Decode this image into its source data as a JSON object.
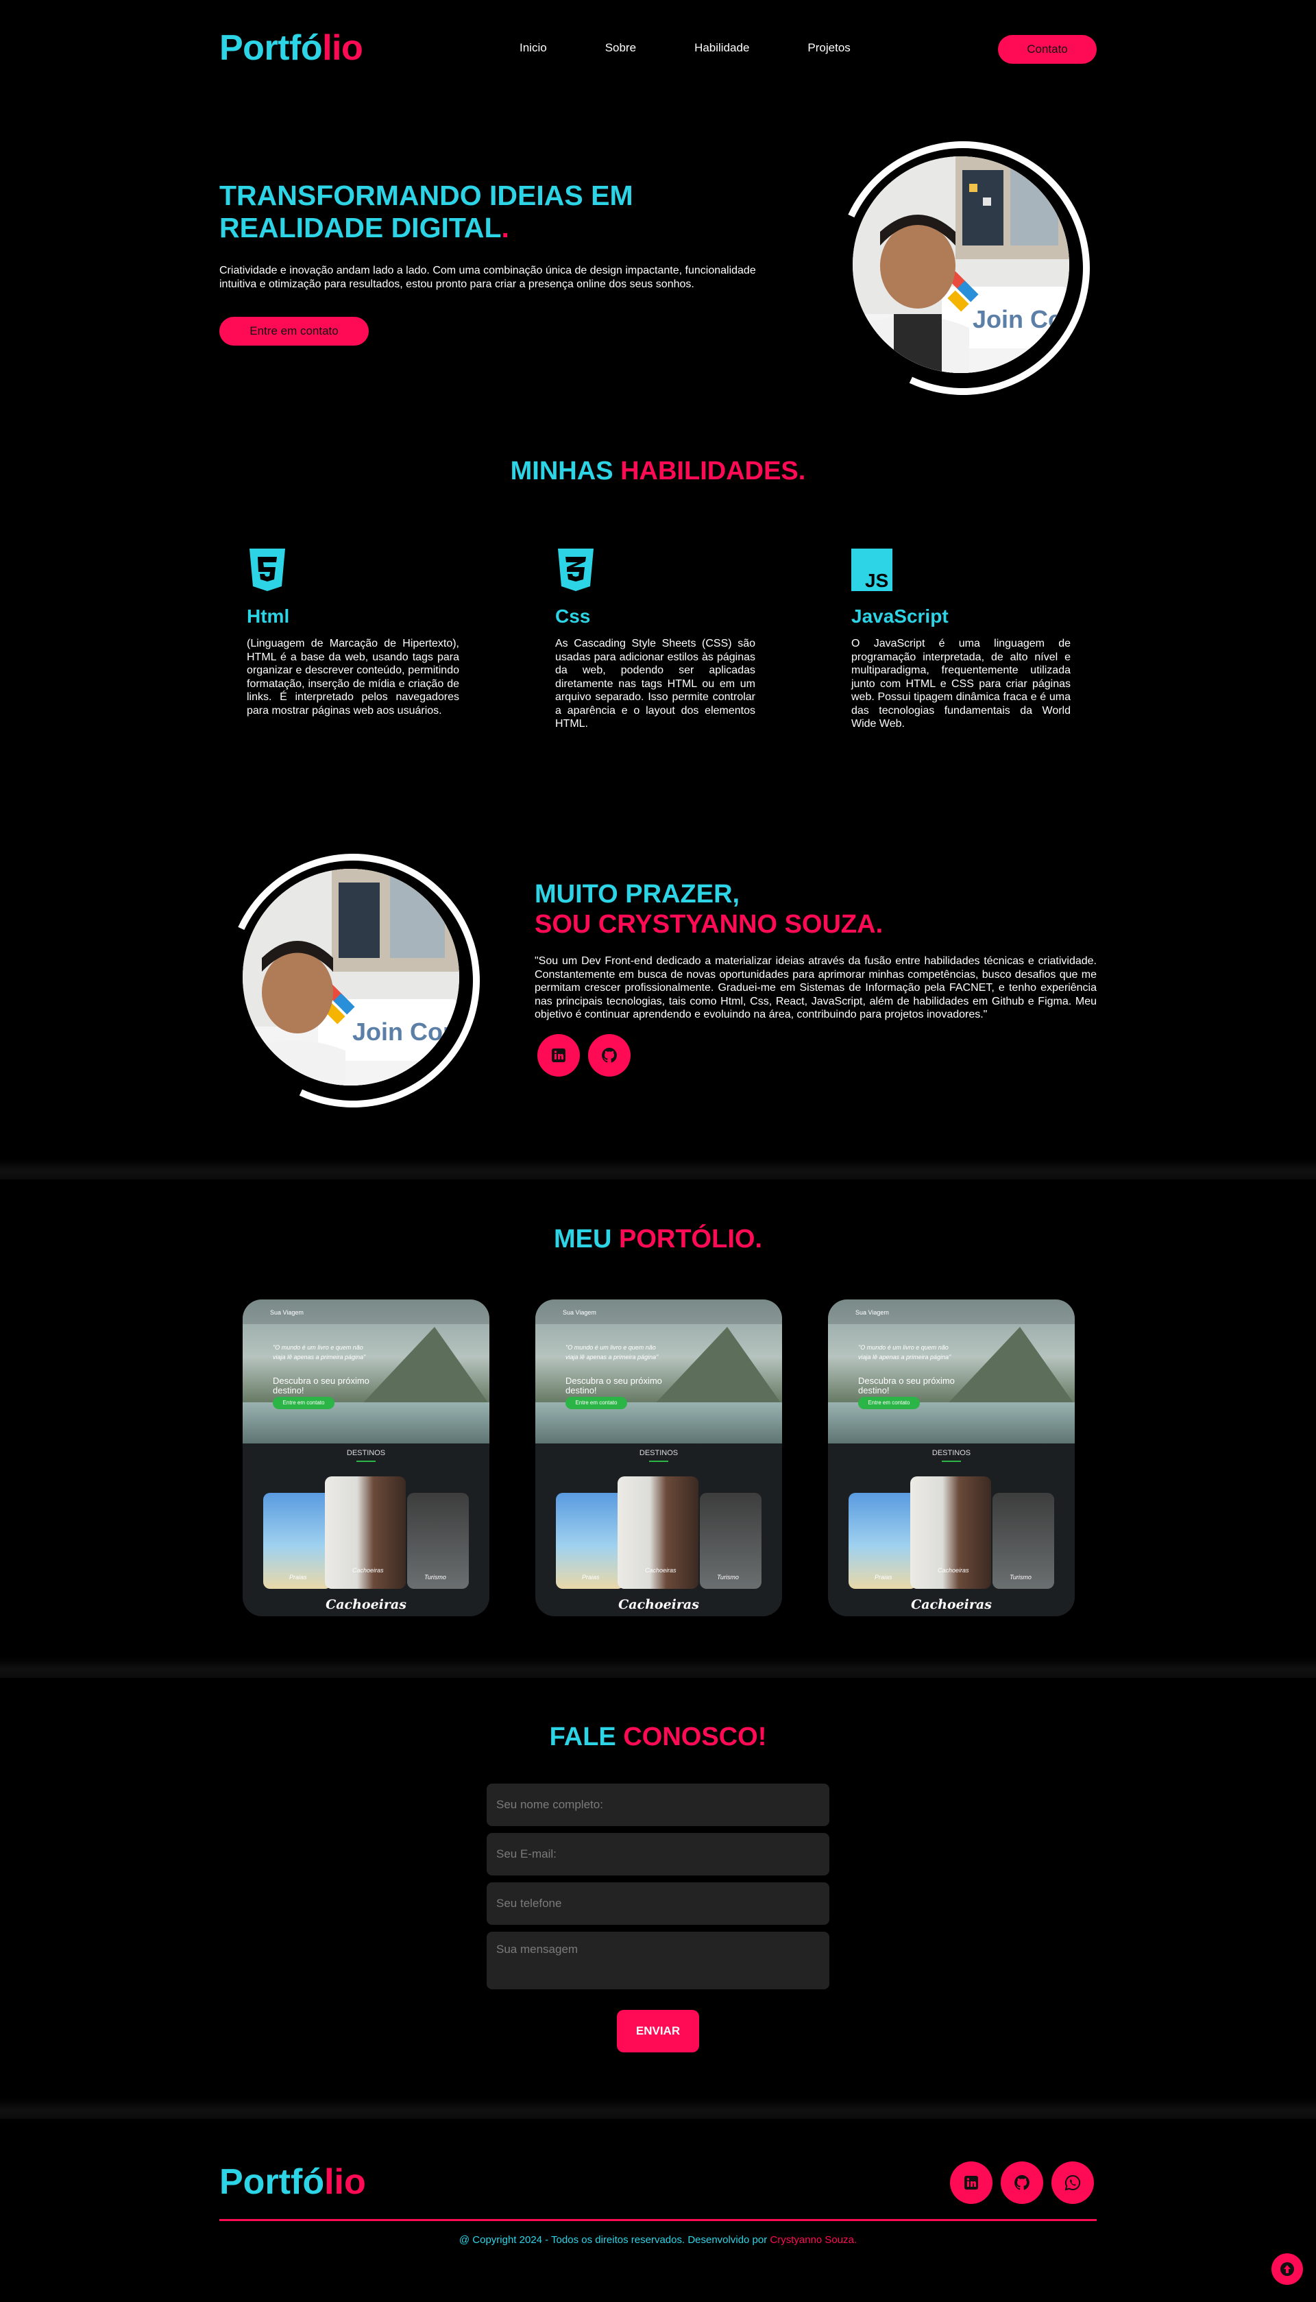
{
  "brand": {
    "logo_part1": "Portfó",
    "logo_part2": "lio"
  },
  "nav": {
    "items": [
      "Inicio",
      "Sobre",
      "Habilidade",
      "Projetos"
    ],
    "contact_label": "Contato"
  },
  "hero": {
    "title_line1": "TRANSFORMANDO IDEIAS EM",
    "title_line2": "REALIDADE DIGITAL",
    "title_dot": ".",
    "text": "Criatividade e inovação andam lado a lado. Com uma combinação única de design impactante, funcionalidade intuitiva e otimização para resultados, estou pronto para criar a presença online dos seus sonhos.",
    "button_label": "Entre em contato",
    "photo_sign": "Join Commu"
  },
  "skills": {
    "title_part1": "MINHAS",
    "title_part2": "HABILIDADES.",
    "items": [
      {
        "name": "Html",
        "icon": "html5-icon",
        "desc": "(Linguagem de Marcação de Hipertexto), HTML é a base da web, usando tags para organizar e descrever conteúdo, permitindo formatação, inserção de mídia e criação de links. É interpretado pelos navegadores para mostrar páginas web aos usuários."
      },
      {
        "name": "Css",
        "icon": "css3-icon",
        "desc": "As Cascading Style Sheets (CSS) são usadas para adicionar estilos às páginas da web, podendo ser aplicadas diretamente nas tags HTML ou em um arquivo separado. Isso permite controlar a aparência e o layout dos elementos HTML."
      },
      {
        "name": "JavaScript",
        "icon": "javascript-icon",
        "icon_text": "JS",
        "desc": "O JavaScript é uma linguagem de programação interpretada, de alto nível e multiparadigma, frequentemente utilizada junto com HTML e CSS para criar páginas web. Possui tipagem dinâmica fraca e é uma das tecnologias fundamentais da World Wide Web."
      }
    ]
  },
  "about": {
    "title_line1": "MUITO PRAZER,",
    "title_line2": "SOU CRYSTYANNO SOUZA.",
    "text": "\"Sou um Dev Front-end dedicado a materializar ideias através da fusão entre habilidades técnicas e criatividade. Constantemente em busca de novas oportunidades para aprimorar minhas competências, busco desafios que me permitam crescer profissionalmente. Graduei-me em Sistemas de Informação pela FACNET, e tenho experiência nas principais tecnologias, tais como Html, Css, React, JavaScript, além de habilidades em Github e Figma. Meu objetivo é continuar aprendendo e evoluindo na área, contribuindo para projetos inovadores.\"",
    "photo_sign": "Join Commu",
    "social_icons": [
      "linkedin-icon",
      "github-icon"
    ]
  },
  "portfolio": {
    "title_part1": "MEU",
    "title_part2": "PORTÓLIO.",
    "cards": [
      {
        "brand": "Sua Viagem",
        "quote": "\"O mundo é um livro e quem não viaja lê apenas a primeira página\"",
        "headline": "Descubra o seu próximo destino!",
        "button": "Entre em contato",
        "section": "DESTINOS",
        "tile_labels": [
          "Praias",
          "Cachoeiras",
          "Turismo"
        ],
        "caption": "Cachoeiras"
      },
      {
        "brand": "Sua Viagem",
        "quote": "\"O mundo é um livro e quem não viaja lê apenas a primeira página\"",
        "headline": "Descubra o seu próximo destino!",
        "button": "Entre em contato",
        "section": "DESTINOS",
        "tile_labels": [
          "Praias",
          "Cachoeiras",
          "Turismo"
        ],
        "caption": "Cachoeiras"
      },
      {
        "brand": "Sua Viagem",
        "quote": "\"O mundo é um livro e quem não viaja lê apenas a primeira página\"",
        "headline": "Descubra o seu próximo destino!",
        "button": "Entre em contato",
        "section": "DESTINOS",
        "tile_labels": [
          "Praias",
          "Cachoeiras",
          "Turismo"
        ],
        "caption": "Cachoeiras"
      }
    ]
  },
  "contact": {
    "title_part1": "FALE",
    "title_part2": "CONOSCO!",
    "name_placeholder": "Seu nome completo:",
    "email_placeholder": "Seu E-mail:",
    "phone_placeholder": "Seu telefone",
    "message_placeholder": "Sua mensagem",
    "send_label": "ENVIAR"
  },
  "footer": {
    "logo_part1": "Portfó",
    "logo_part2": "lio",
    "copyright_text": "@ Copyright 2024 - Todos os direitos reservados. Desenvolvido por ",
    "author": "Crystyanno Souza.",
    "social_icons": [
      "linkedin-icon",
      "github-icon",
      "whatsapp-icon"
    ]
  },
  "colors": {
    "accent_cyan": "#2dd4e6",
    "accent_pink": "#ff0a54",
    "background": "#000000"
  }
}
